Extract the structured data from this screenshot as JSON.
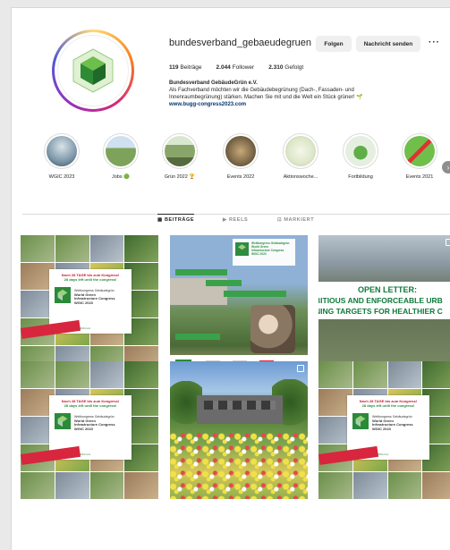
{
  "profile": {
    "username": "bundesverband_gebaeudegruen",
    "follow_label": "Folgen",
    "message_label": "Nachricht senden",
    "more_label": "···",
    "posts_count": "119",
    "posts_label": "Beiträge",
    "followers_count": "2.044",
    "followers_label": "Follower",
    "following_count": "2.310",
    "following_label": "Gefolgt",
    "display_name": "Bundesverband GebäudeGrün e.V.",
    "bio_line1": "Als Fachverband möchten wir die Gebäudebegrünung (Dach-, Fassaden- und",
    "bio_line2": "Innenraumbegrünung) stärken. Machen Sie mit und die Welt ein Stück grüner! 🌱",
    "link": "www.bugg-congress2023.com"
  },
  "highlights": [
    {
      "label": "WGIC 2023",
      "color": "#7c96a8"
    },
    {
      "label": "Jobs 🟢",
      "color": "#7da35a"
    },
    {
      "label": "Grün 2022 🏆",
      "color": "#8aa56a"
    },
    {
      "label": "Events 2022",
      "color": "#6b5a3e"
    },
    {
      "label": "Aktionswoche...",
      "color": "#dde6c8"
    },
    {
      "label": "Fortbildung",
      "color": "#e5efe0"
    },
    {
      "label": "Events 2021",
      "color": "#6fbf4a"
    }
  ],
  "tabs": {
    "posts": "BEITRÄGE",
    "reels": "REELS",
    "tagged": "MARKIERT"
  },
  "posts": {
    "congress_card": {
      "head1": "Noch 28 TAGE bis zum Kongress!",
      "head2": "28 days left until the congress!",
      "title1": "Weltkongress Gebäudegrün",
      "title2": "World Green",
      "title3": "Infrastructure Congress",
      "title4": "WGIC 2023",
      "url": "www.bugg-congress2023.com"
    },
    "open_letter": {
      "line1": "OPEN LETTER:",
      "line2": "BITIOUS AND ENFORCEABLE URB",
      "line3": "NING TARGETS FOR HEALTHIER C"
    },
    "p2_logo": "BuGG"
  },
  "colors": {
    "accent_green": "#2a8a3a",
    "link_blue": "#00376b"
  }
}
